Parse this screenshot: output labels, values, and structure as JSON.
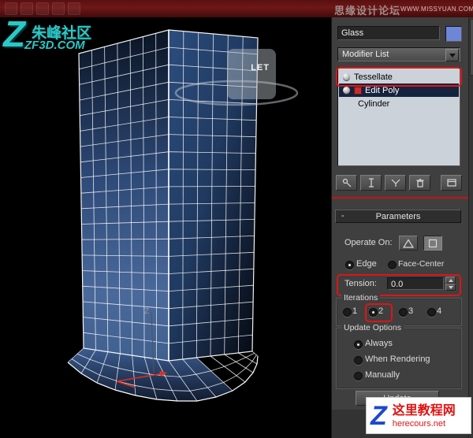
{
  "top_bar": {
    "watermark_text": "思缘设计论坛",
    "watermark_site": "WWW.MISSYUAN.COM"
  },
  "viewport": {
    "logo_letter": "Z",
    "logo_title": "朱峰社区",
    "logo_site": "ZF3D.COM",
    "ghost_label": "LET",
    "axis_z_label": "Z"
  },
  "panel": {
    "material_name": "Glass",
    "modifier_list_label": "Modifier List",
    "stack_items": [
      {
        "label": "Tessellate"
      },
      {
        "label": "Edit Poly"
      },
      {
        "label": "Cylinder"
      }
    ],
    "stack_toolbar_icons": [
      "pin-stack-icon",
      "show-end-result-icon",
      "make-unique-icon",
      "remove-modifier-icon",
      "configure-modifier-sets-icon"
    ],
    "parameters": {
      "collapse_glyph": "-",
      "title": "Parameters",
      "operate_on_label": "Operate On:",
      "operate_icons": [
        "triangle-icon",
        "square-icon"
      ],
      "mode_options": [
        "Edge",
        "Face-Center"
      ],
      "mode_selected": "Edge",
      "tension_label": "Tension:",
      "tension_value": "0.0",
      "iterations_label": "Iterations",
      "iteration_options": [
        "1",
        "2",
        "3",
        "4"
      ],
      "iteration_selected": "2",
      "update_options_label": "Update Options",
      "update_option_items": [
        "Always",
        "When Rendering",
        "Manually"
      ],
      "update_option_selected": "Always",
      "update_button_label": "Update"
    }
  },
  "footer_logo": {
    "letter": "Z",
    "title": "这里教程网",
    "site": "herecours.net"
  },
  "colors": {
    "annotation_red": "#de1515",
    "material_swatch_blue": "#6e86d8",
    "logo_teal": "#2cc7c7",
    "selected_stack_row": "#15233e",
    "topbar_maroon": "#5a1010"
  }
}
